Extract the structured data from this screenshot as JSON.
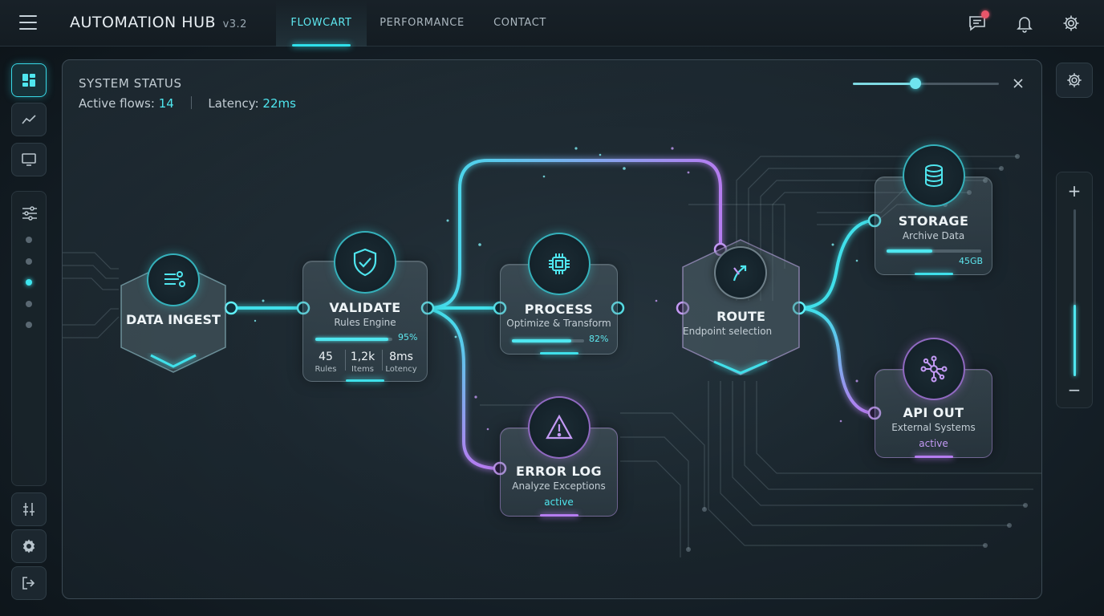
{
  "colors": {
    "accent_cyan": "#3fe0ea",
    "accent_purple": "#b57cf0",
    "badge_red": "#e8566a"
  },
  "header": {
    "menu_icon": "hamburger-icon",
    "title": "AUTOMATION HUB",
    "version": "v3.2",
    "tabs": [
      {
        "label": "FLOWCART",
        "active": true
      },
      {
        "label": "PERFORMANCE",
        "active": false
      },
      {
        "label": "CONTACT",
        "active": false
      }
    ],
    "icons": [
      "chat-icon",
      "bell-icon",
      "gear-icon"
    ],
    "chat_has_notification": true
  },
  "sidebar": {
    "top_buttons": [
      {
        "icon": "dashboard-icon",
        "active": true
      },
      {
        "icon": "line-chart-icon",
        "active": false
      },
      {
        "icon": "monitor-icon",
        "active": false
      }
    ],
    "panel_icon": "sliders-icon",
    "dots": [
      false,
      false,
      true,
      false,
      false
    ],
    "bottom_buttons": [
      {
        "icon": "adjust-icon"
      },
      {
        "icon": "gear-icon"
      },
      {
        "icon": "logout-icon"
      }
    ]
  },
  "status": {
    "title": "SYSTEM STATUS",
    "active_flows_label": "Active flows:",
    "active_flows_value": "14",
    "latency_label": "Latency:",
    "latency_value": "22ms",
    "slider_level": 0.43
  },
  "nodes": {
    "data_ingest": {
      "title": "DATA INGEST",
      "icon": "data-stream-icon"
    },
    "validate": {
      "title": "VALIDATE",
      "subtitle": "Rules Engine",
      "icon": "shield-check-icon",
      "progress": 0.95,
      "progress_label": "95%",
      "stats": [
        {
          "value": "45",
          "label": "Rules"
        },
        {
          "value": "1,2k",
          "label": "Items"
        },
        {
          "value": "8ms",
          "label": "Lotency"
        }
      ]
    },
    "process": {
      "title": "PROCESS",
      "subtitle": "Optimize & Transform",
      "icon": "cpu-chip-icon",
      "progress": 0.82,
      "progress_label": "82%"
    },
    "route": {
      "title": "ROUTE",
      "subtitle": "Endpoint selection",
      "icon": "route-split-icon"
    },
    "error_log": {
      "title": "ERROR LOG",
      "subtitle": "Analyze Exceptions",
      "state": "active",
      "icon": "warning-icon"
    },
    "storage": {
      "title": "STORAGE",
      "subtitle": "Archive Data",
      "icon": "database-icon",
      "progress": 0.48,
      "progress_label": "45GB"
    },
    "api_out": {
      "title": "API OUT",
      "subtitle": "External Systems",
      "state": "active",
      "icon": "network-icon"
    }
  },
  "right_controls": {
    "settings_icon": "gear-icon",
    "zoom_in": "+",
    "zoom_out": "−",
    "zoom_level": 0.43
  }
}
